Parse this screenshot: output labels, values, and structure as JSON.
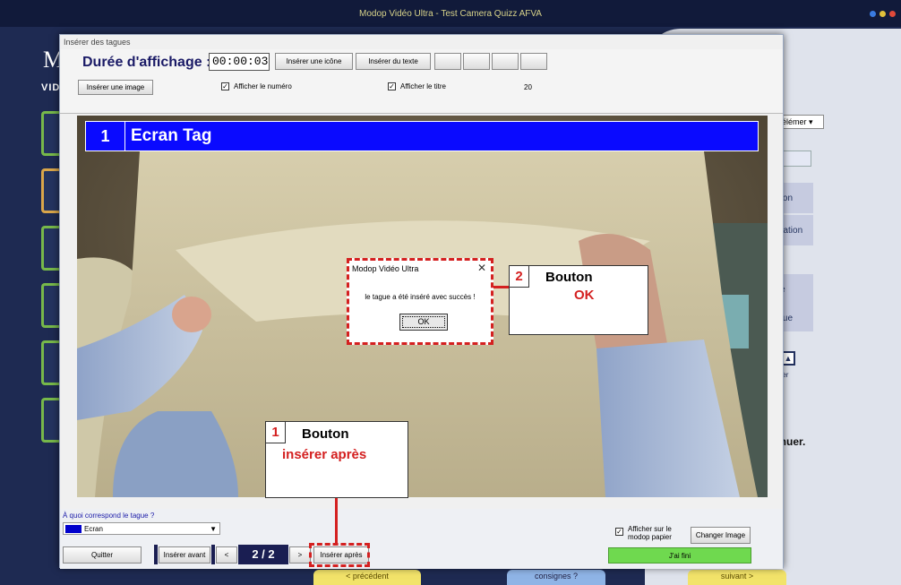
{
  "background_app": {
    "window_title": "Modop Vidéo Ultra - Test Camera Quizz AFVA",
    "logo_letter": "M",
    "logo_sub": "VID",
    "right_panel": {
      "select_value": "élémer",
      "items": [
        "ration",
        "pération",
        "gue",
        "tague"
      ],
      "up_label": "célérer",
      "continue_text": "ntinuer."
    },
    "bottom_buttons": [
      "< précédent",
      "consignes ?",
      "suivant >"
    ]
  },
  "dialog": {
    "title": "Insérer des tagues",
    "duration_label": "Durée d'affichage :",
    "duration_value": "00:00:03",
    "insert_icon_label": "Insérer une icône",
    "insert_text_label": "Insérer du texte",
    "insert_image_label": "Insérer une image",
    "show_number_label": "Afficher le numéro",
    "show_number_checked": true,
    "show_title_label": "Afficher le titre",
    "show_title_checked": true,
    "count_value": "20"
  },
  "video_overlay": {
    "tag_number": "1",
    "tag_title": "Ecran Tag"
  },
  "message_box": {
    "title": "Modop Vidéo Ultra",
    "close_glyph": "✕",
    "message": "le tague a été inséré avec succès !",
    "ok_label": "OK"
  },
  "callouts": [
    {
      "number": "2",
      "title": "Bouton",
      "subtitle": "OK"
    },
    {
      "number": "1",
      "title": "Bouton",
      "subtitle": "insérer après"
    }
  ],
  "bottom": {
    "question": "À quoi correspond le tague ?",
    "type_value": "Ecran",
    "type_color": "#0000cc",
    "print_label_line1": "Afficher sur le",
    "print_label_line2": "modop papier",
    "print_checked": true,
    "change_image_label": "Changer Image",
    "quit_label": "Quitter",
    "insert_before_label": "Insérer avant",
    "prev_label": "<",
    "page_indicator": "2 / 2",
    "next_label": ">",
    "insert_after_label": "Insérer après",
    "done_label": "J'ai fini"
  },
  "colors": {
    "accent_red": "#d42020",
    "tag_blue": "#0a0aff",
    "done_green": "#6fd94f"
  }
}
